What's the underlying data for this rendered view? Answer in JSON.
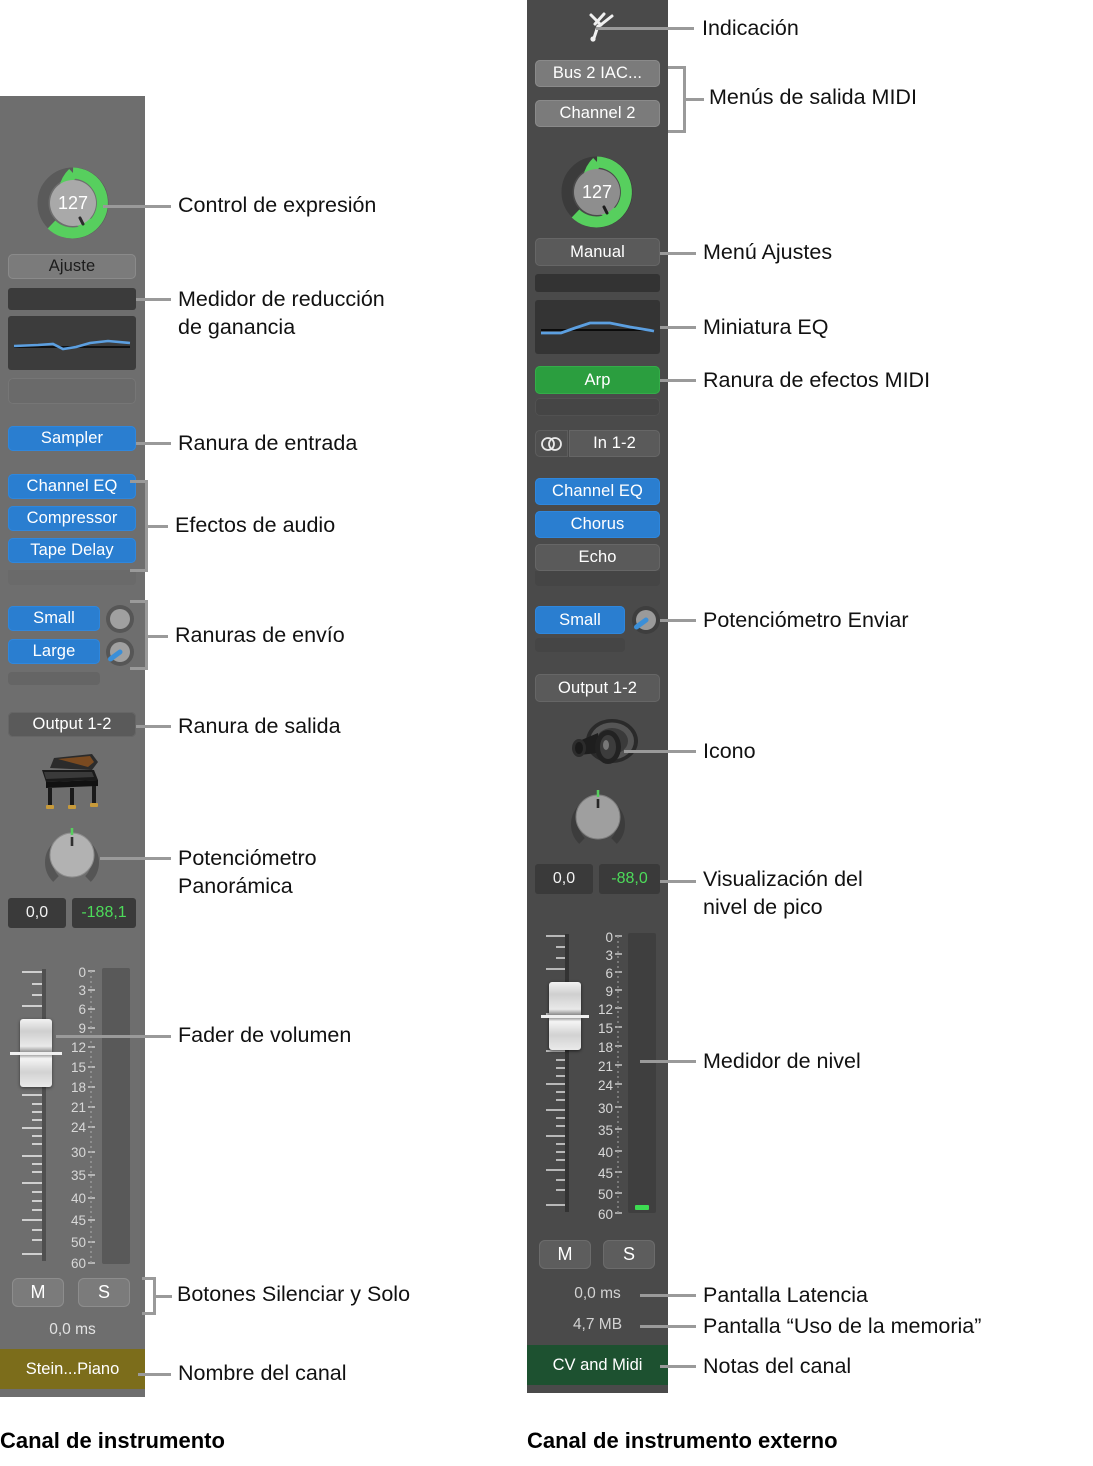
{
  "left_channel": {
    "expression": {
      "value": "127",
      "color_ring": "#57cf5e"
    },
    "settings_menu": "Ajuste",
    "input_slot": "Sampler",
    "audio_effects": [
      "Channel EQ",
      "Compressor",
      "Tape Delay"
    ],
    "sends": [
      "Small",
      "Large"
    ],
    "output_slot": "Output 1-2",
    "icon_name": "grand-piano-icon",
    "pan_display": "0,0",
    "peak_display": "-188,1",
    "scale_labels": [
      "0",
      "3",
      "6",
      "9",
      "12",
      "15",
      "18",
      "21",
      "24",
      "30",
      "35",
      "40",
      "45",
      "50",
      "60"
    ],
    "mute_label": "M",
    "solo_label": "S",
    "latency": "0,0 ms",
    "channel_name": "Stein...Piano",
    "nameplate_color": "#7c6d1b",
    "caption": "Canal de instrumento"
  },
  "right_channel": {
    "indication_icon": "tuning-fork-icon",
    "midi_out_menus": [
      "Bus 2 IAC...",
      "Channel 2"
    ],
    "expression": {
      "value": "127",
      "color_ring": "#57cf5e"
    },
    "settings_menu": "Manual",
    "midi_fx_slot": "Arp",
    "input_slot": "In 1-2",
    "stereo_icon": "stereo-link-icon",
    "audio_effects": [
      "Channel EQ",
      "Chorus",
      "Echo"
    ],
    "sends": [
      "Small"
    ],
    "output_slot": "Output 1-2",
    "icon_name": "speaker-icon",
    "pan_display": "0,0",
    "peak_display": "-88,0",
    "scale_labels": [
      "0",
      "3",
      "6",
      "9",
      "12",
      "15",
      "18",
      "21",
      "24",
      "30",
      "35",
      "40",
      "45",
      "50",
      "60"
    ],
    "mute_label": "M",
    "solo_label": "S",
    "latency": "0,0 ms",
    "memory_usage": "4,7 MB",
    "channel_notes": "CV and Midi",
    "notes_color": "#1d5130",
    "caption": "Canal de instrumento externo"
  },
  "annotations": {
    "left": [
      {
        "id": "expression",
        "text": "Control de expresión"
      },
      {
        "id": "gain-reduction",
        "text": "Medidor de reducción\nde ganancia"
      },
      {
        "id": "input-slot",
        "text": "Ranura de entrada"
      },
      {
        "id": "audio-effects",
        "text": "Efectos de audio"
      },
      {
        "id": "send-slots",
        "text": "Ranuras de envío"
      },
      {
        "id": "output-slot",
        "text": "Ranura de salida"
      },
      {
        "id": "pan-knob",
        "text": "Potenciómetro\nPanorámica"
      },
      {
        "id": "volume-fader",
        "text": "Fader de volumen"
      },
      {
        "id": "mute-solo",
        "text": "Botones Silenciar y Solo"
      },
      {
        "id": "channel-name",
        "text": "Nombre del canal"
      }
    ],
    "right": [
      {
        "id": "indication",
        "text": "Indicación"
      },
      {
        "id": "midi-output-menus",
        "text": "Menús de salida MIDI"
      },
      {
        "id": "settings-menu",
        "text": "Menú Ajustes"
      },
      {
        "id": "eq-thumbnail",
        "text": "Miniatura EQ"
      },
      {
        "id": "midi-fx-slot",
        "text": "Ranura de efectos MIDI"
      },
      {
        "id": "send-knob",
        "text": "Potenciómetro Enviar"
      },
      {
        "id": "icon",
        "text": "Icono"
      },
      {
        "id": "peak-level-display",
        "text": "Visualización del\nnivel de pico"
      },
      {
        "id": "level-meter",
        "text": "Medidor de nivel"
      },
      {
        "id": "latency-display",
        "text": "Pantalla Latencia"
      },
      {
        "id": "memory-display",
        "text": "Pantalla “Uso de la memoria”"
      },
      {
        "id": "channel-notes",
        "text": "Notas del canal"
      }
    ]
  },
  "colors": {
    "strip_bg_left": "#6e6e6e",
    "strip_bg_right": "#4a4a4a",
    "accent_blue": "#2a7ed0",
    "accent_green": "#2b9e3f",
    "leader": "#9a9a9a"
  }
}
